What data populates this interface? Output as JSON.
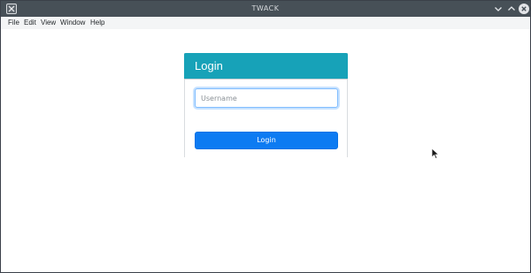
{
  "window": {
    "title": "TWACK",
    "icons": {
      "app": "app-x-icon",
      "minimize": "chevron-down-icon",
      "maximize": "chevron-up-icon",
      "close": "close-icon"
    }
  },
  "menubar": {
    "items": [
      "File",
      "Edit",
      "View",
      "Window",
      "Help"
    ]
  },
  "login": {
    "title": "Login",
    "username_placeholder": "Username",
    "username_value": "",
    "button_label": "Login"
  },
  "colors": {
    "titlebar": "#475057",
    "header": "#17a2b8",
    "button": "#0d7bf2",
    "input_focus": "#80bdff"
  }
}
